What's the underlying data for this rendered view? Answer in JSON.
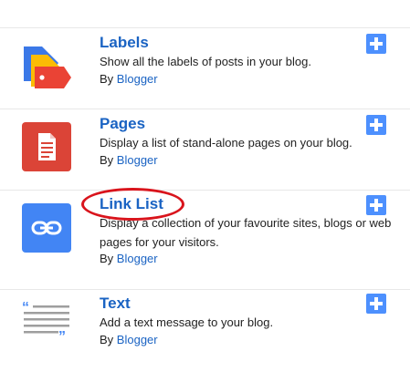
{
  "gadgets": [
    {
      "title": "Labels",
      "description": "Show all the labels of posts in your blog.",
      "by_prefix": "By",
      "by_link": "Blogger",
      "icon": "labels-tag-icon",
      "icon_colors": [
        "#3b78e7",
        "#fbbc05",
        "#ea4335"
      ]
    },
    {
      "title": "Pages",
      "description": "Display a list of stand-alone pages on your blog.",
      "by_prefix": "By",
      "by_link": "Blogger",
      "icon": "pages-document-icon",
      "icon_colors": [
        "#db4437"
      ]
    },
    {
      "title": "Link List",
      "description": "Display a collection of your favourite sites, blogs or web pages for your visitors.",
      "by_prefix": "By",
      "by_link": "Blogger",
      "icon": "link-chain-icon",
      "icon_colors": [
        "#4285f4"
      ]
    },
    {
      "title": "Text",
      "description": "Add a text message to your blog.",
      "by_prefix": "By",
      "by_link": "Blogger",
      "icon": "text-quote-icon",
      "icon_colors": [
        "#9e9e9e",
        "#4285f4"
      ]
    }
  ],
  "add_button_icon": "plus-icon",
  "colors": {
    "title": "#1a63c3",
    "add_button": "#4d90fe",
    "annotation": "#d9141c"
  }
}
